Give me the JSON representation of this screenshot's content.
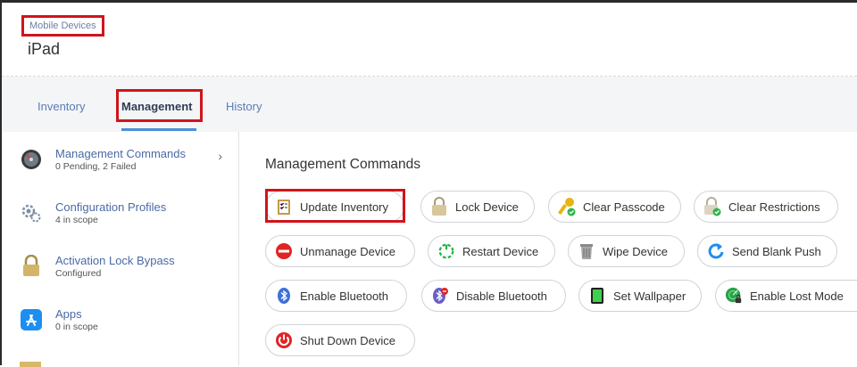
{
  "header": {
    "breadcrumb": "Mobile Devices",
    "title": "iPad"
  },
  "tabs": [
    {
      "label": "Inventory",
      "active": false
    },
    {
      "label": "Management",
      "active": true
    },
    {
      "label": "History",
      "active": false
    }
  ],
  "sidebar": {
    "items": [
      {
        "title": "Management Commands",
        "subtitle": "0 Pending, 2 Failed",
        "icon": "gauge-icon"
      },
      {
        "title": "Configuration Profiles",
        "subtitle": "4 in scope",
        "icon": "gears-icon"
      },
      {
        "title": "Activation Lock Bypass",
        "subtitle": "Configured",
        "icon": "padlock-icon"
      },
      {
        "title": "Apps",
        "subtitle": "0 in scope",
        "icon": "app-store-icon"
      }
    ]
  },
  "main": {
    "section_title": "Management Commands",
    "commands": [
      {
        "label": "Update Inventory",
        "icon": "clipboard-checklist-icon"
      },
      {
        "label": "Lock Device",
        "icon": "padlock-icon"
      },
      {
        "label": "Clear Passcode",
        "icon": "key-check-icon"
      },
      {
        "label": "Clear Restrictions",
        "icon": "padlock-check-icon"
      },
      {
        "label": "Unmanage Device",
        "icon": "no-entry-icon"
      },
      {
        "label": "Restart Device",
        "icon": "restart-icon"
      },
      {
        "label": "Wipe Device",
        "icon": "trash-can-icon"
      },
      {
        "label": "Send Blank Push",
        "icon": "refresh-arrow-icon"
      },
      {
        "label": "Enable Bluetooth",
        "icon": "bluetooth-icon"
      },
      {
        "label": "Disable Bluetooth",
        "icon": "bluetooth-disabled-icon"
      },
      {
        "label": "Set Wallpaper",
        "icon": "tablet-wallpaper-icon"
      },
      {
        "label": "Enable Lost Mode",
        "icon": "radar-lock-icon"
      },
      {
        "label": "Shut Down Device",
        "icon": "power-icon"
      }
    ]
  },
  "colors": {
    "accent": "#4a90d9",
    "highlight": "#d0141c",
    "link": "#4a6aa5"
  }
}
